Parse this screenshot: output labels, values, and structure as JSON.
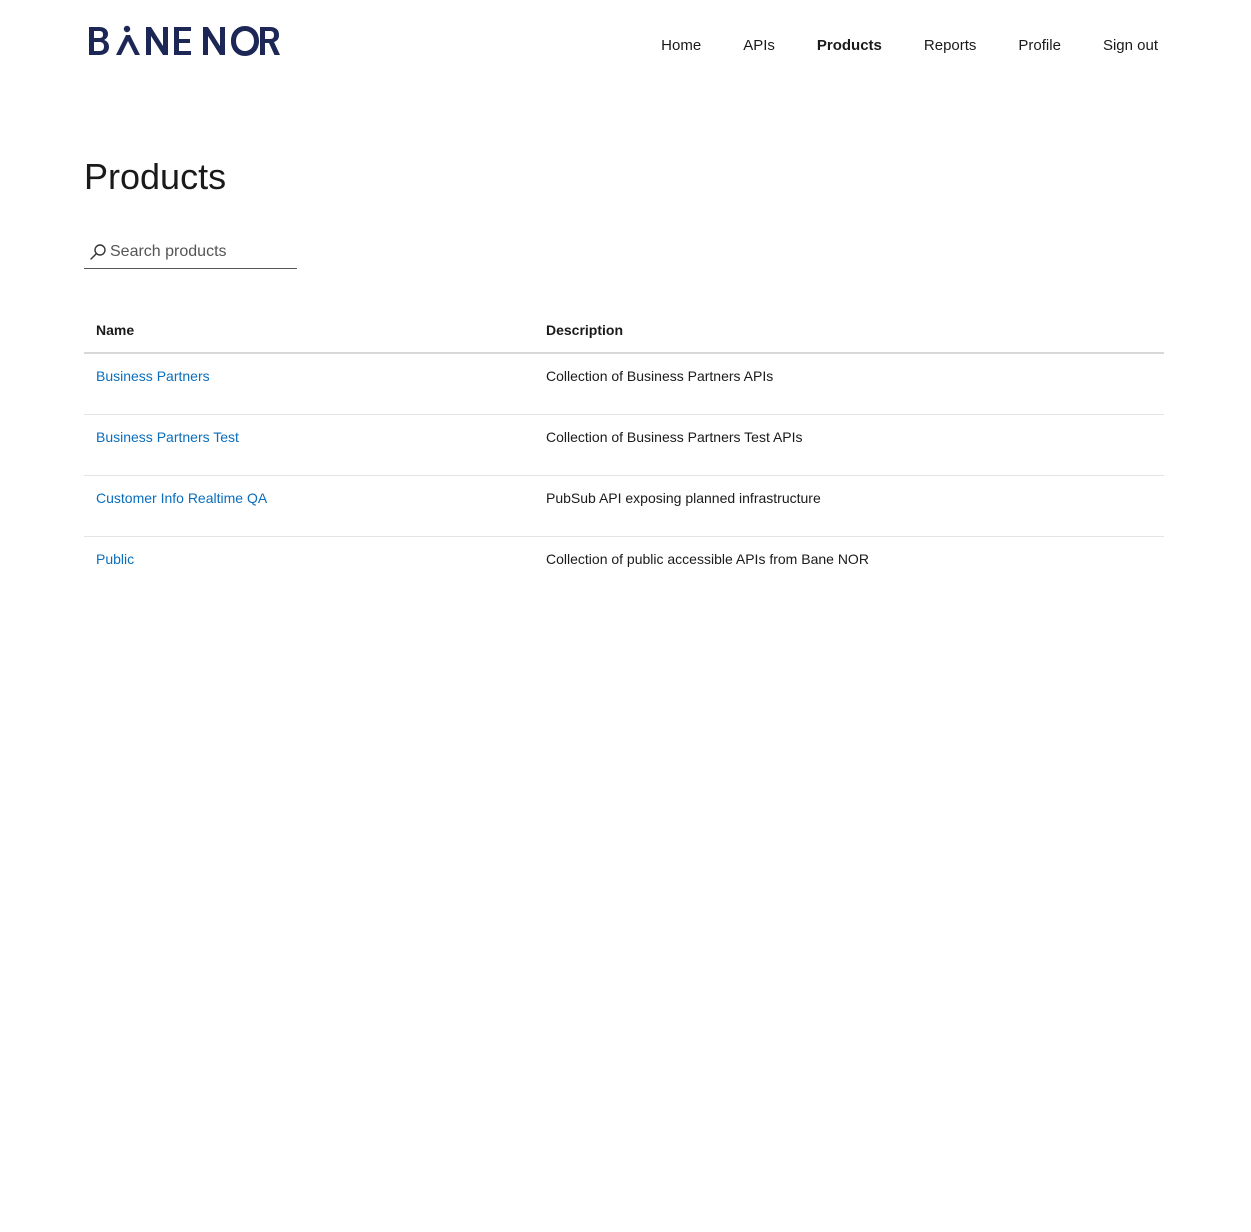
{
  "header": {
    "logo_text": "BANE NOR",
    "nav": [
      {
        "label": "Home",
        "active": false
      },
      {
        "label": "APIs",
        "active": false
      },
      {
        "label": "Products",
        "active": true
      },
      {
        "label": "Reports",
        "active": false
      },
      {
        "label": "Profile",
        "active": false
      },
      {
        "label": "Sign out",
        "active": false
      }
    ]
  },
  "main": {
    "title": "Products",
    "search": {
      "placeholder": "Search products",
      "value": "",
      "icon": "search-icon"
    },
    "table": {
      "columns": [
        "Name",
        "Description"
      ],
      "rows": [
        {
          "name": "Business Partners",
          "description": "Collection of Business Partners APIs"
        },
        {
          "name": "Business Partners Test",
          "description": "Collection of Business Partners Test APIs"
        },
        {
          "name": "Customer Info Realtime QA",
          "description": "PubSub API exposing planned infrastructure"
        },
        {
          "name": "Public",
          "description": "Collection of public accessible APIs from Bane NOR"
        }
      ]
    }
  },
  "colors": {
    "brand": "#1c2756",
    "link": "#0a6ebd",
    "text": "#1a1a1a"
  }
}
